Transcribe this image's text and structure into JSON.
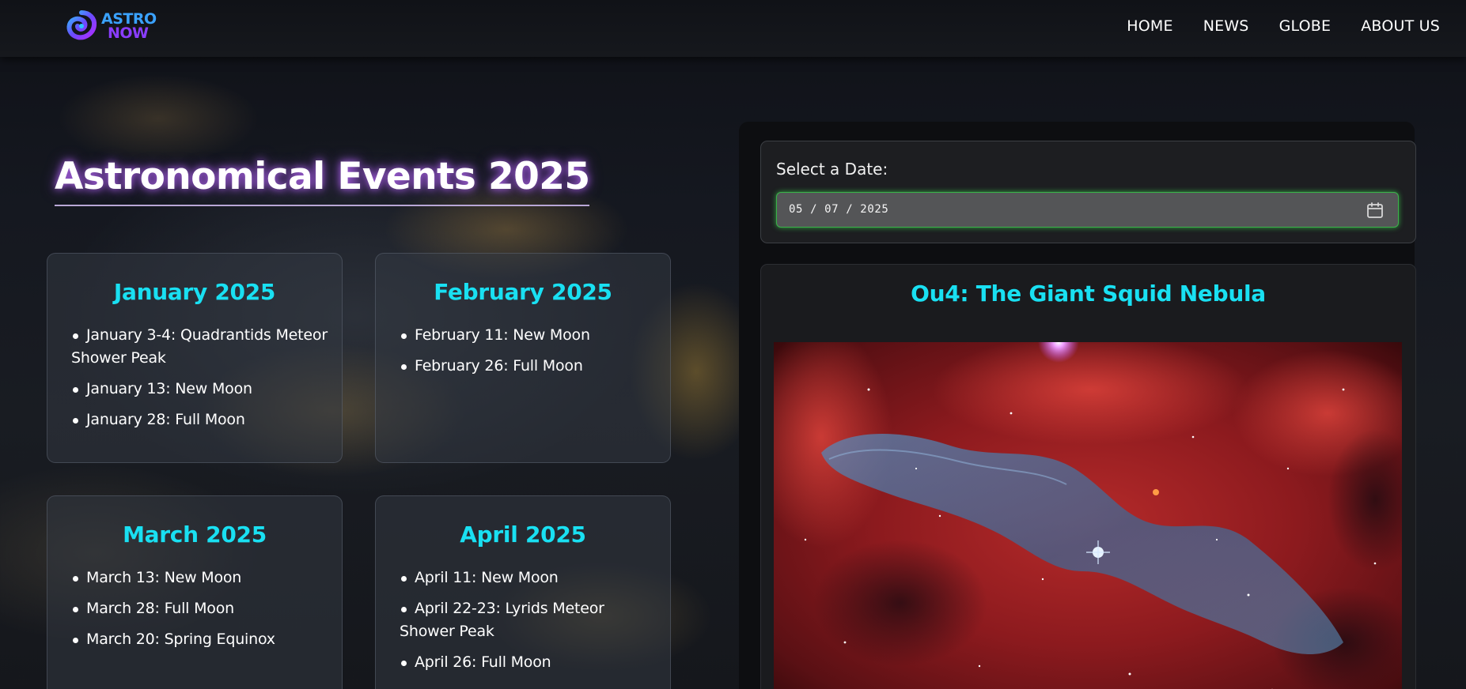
{
  "header": {
    "logo": {
      "line1": "ASTRO",
      "line2": "NOW"
    },
    "nav": [
      {
        "label": "HOME"
      },
      {
        "label": "NEWS"
      },
      {
        "label": "GLOBE"
      },
      {
        "label": "ABOUT US"
      }
    ]
  },
  "main": {
    "title": "Astronomical Events 2025",
    "months": [
      {
        "title": "January 2025",
        "events": [
          "January 3-4: Quadrantids Meteor Shower Peak",
          "January 13: New Moon",
          "January 28: Full Moon"
        ]
      },
      {
        "title": "February 2025",
        "events": [
          "February 11: New Moon",
          "February 26: Full Moon"
        ]
      },
      {
        "title": "March 2025",
        "events": [
          "March 13: New Moon",
          "March 28: Full Moon",
          "March 20: Spring Equinox"
        ]
      },
      {
        "title": "April 2025",
        "events": [
          "April 11: New Moon",
          "April 22-23: Lyrids Meteor Shower Peak",
          "April 26: Full Moon"
        ]
      }
    ]
  },
  "sidebar": {
    "date_label": "Select a Date:",
    "date_value": "05 / 07 / 2025",
    "calendar_icon": "calendar-icon",
    "apod_title": "Ou4: The Giant Squid Nebula"
  },
  "colors": {
    "accent_cyan": "#19e0f2",
    "input_glow_green": "#3bb24a",
    "title_glow_purple": "#b06bff",
    "logo_blue": "#3aa2ff",
    "logo_purple": "#8a3dff"
  }
}
